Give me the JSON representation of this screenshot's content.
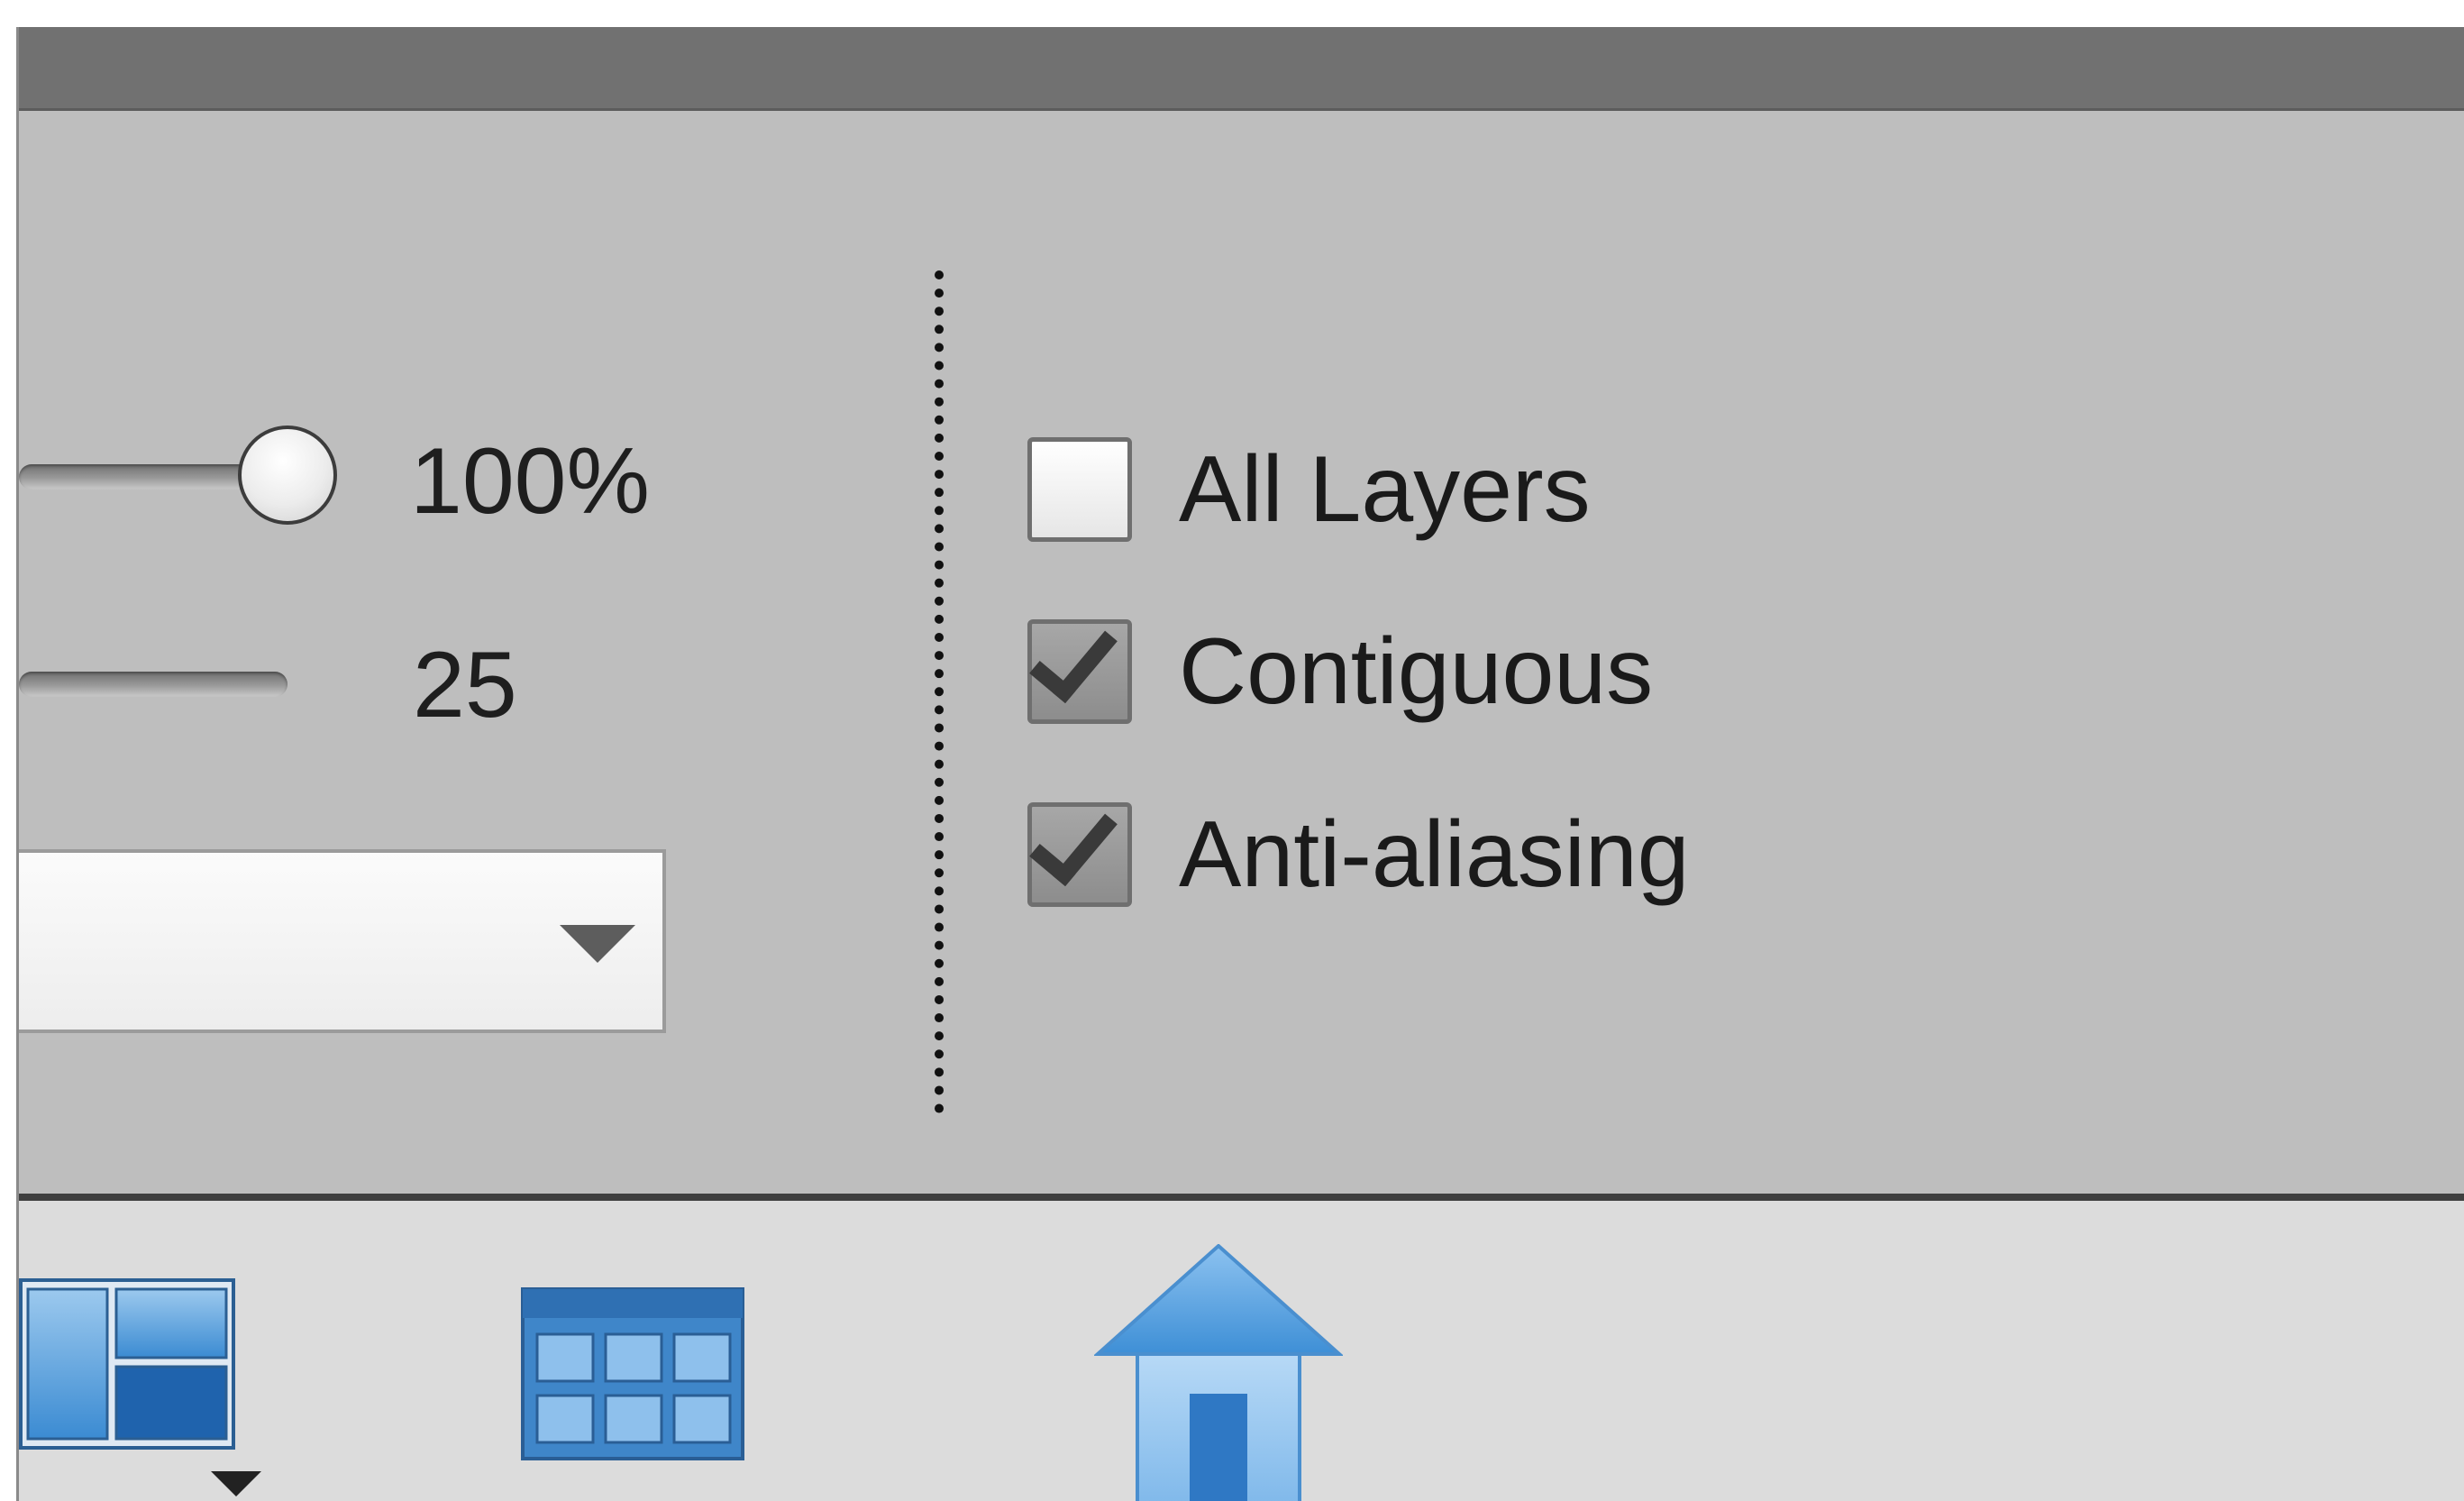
{
  "options": {
    "opacity": {
      "value_label": "100%",
      "level_percent": 100
    },
    "tolerance": {
      "value_label": "25"
    },
    "dropdown": {
      "selected": ""
    },
    "checkboxes": [
      {
        "label": "All Layers",
        "checked": false
      },
      {
        "label": "Contiguous",
        "checked": true
      },
      {
        "label": "Anti-aliasing",
        "checked": true
      }
    ]
  },
  "bottom_bar": {
    "icons": [
      "layout-icon",
      "grid-view-icon",
      "home-icon"
    ]
  },
  "colors": {
    "panel_bg": "#bebebe",
    "title_bar": "#717171",
    "bottom_bar": "#dcdcdc",
    "icon_blue": "#3e8fd6"
  }
}
